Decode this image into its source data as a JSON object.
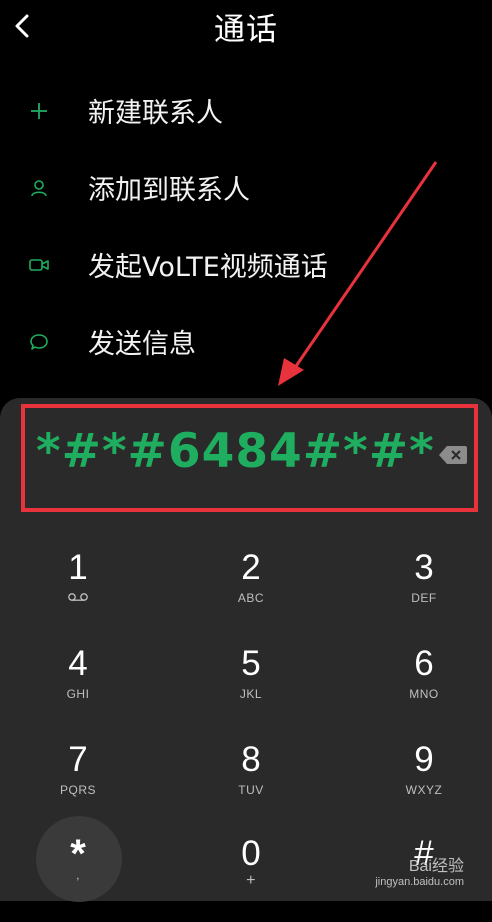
{
  "header": {
    "title": "通话",
    "back_icon": "chevron-left-icon"
  },
  "menu": [
    {
      "icon": "plus-icon",
      "label": "新建联系人"
    },
    {
      "icon": "person-icon",
      "label": "添加到联系人"
    },
    {
      "icon": "video-camera-icon",
      "label": "发起VoLTE视频通话"
    },
    {
      "icon": "chat-bubble-icon",
      "label": "发送信息"
    }
  ],
  "dialer": {
    "number": "*#*#6484#*#*",
    "delete_icon": "backspace-icon",
    "keys": [
      {
        "digit": "1",
        "letters": "voicemail-icon"
      },
      {
        "digit": "2",
        "letters": "ABC"
      },
      {
        "digit": "3",
        "letters": "DEF"
      },
      {
        "digit": "4",
        "letters": "GHI"
      },
      {
        "digit": "5",
        "letters": "JKL"
      },
      {
        "digit": "6",
        "letters": "MNO"
      },
      {
        "digit": "7",
        "letters": "PQRS"
      },
      {
        "digit": "8",
        "letters": "TUV"
      },
      {
        "digit": "9",
        "letters": "WXYZ"
      },
      {
        "digit": "*",
        "letters": ","
      },
      {
        "digit": "0",
        "letters": "+"
      },
      {
        "digit": "#",
        "letters": ""
      }
    ]
  },
  "colors": {
    "accent_green": "#1fae5f",
    "highlight_red": "#e8323c",
    "dialer_bg": "#2a2a2a"
  },
  "watermark": {
    "brand": "Bai经验",
    "url": "jingyan.baidu.com"
  }
}
